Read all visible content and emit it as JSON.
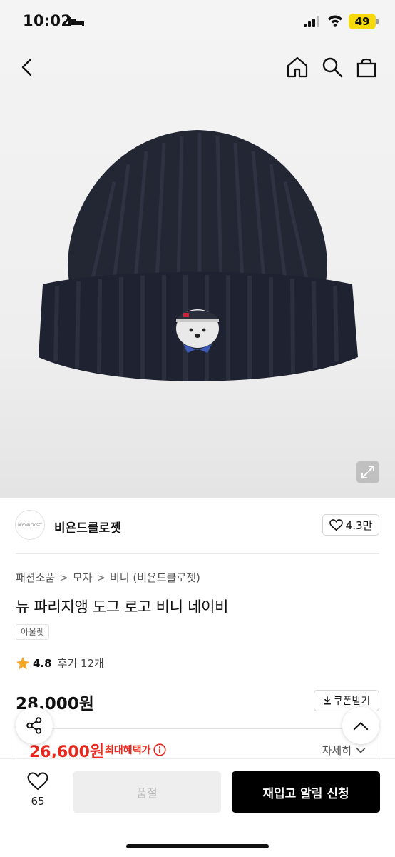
{
  "status_bar": {
    "time": "10:02",
    "battery": "49"
  },
  "brand": {
    "logo_text": "BEYOND CLOSET",
    "name": "비욘드클로젯",
    "likes": "4.3만"
  },
  "breadcrumb": [
    "패션소품",
    "모자",
    "비니 (비욘드클로젯)"
  ],
  "breadcrumb_separator": ">",
  "product": {
    "title": "뉴 파리지앵 도그 로고 비니 네이비",
    "tag": "아울렛",
    "rating": "4.8",
    "reviews": "후기 12개",
    "price": "28,000원",
    "coupon_label": "쿠폰받기",
    "sale_price": "26,600원",
    "max_benefit_label": "최대혜택가",
    "details_label": "자세히"
  },
  "bottom_bar": {
    "wish_count": "65",
    "soldout_label": "품절",
    "restock_label": "재입고 알림 신청"
  },
  "colors": {
    "accent_red": "#e8271d",
    "battery": "#f6d90a",
    "star": "#f5a623"
  },
  "icons": [
    "bed-icon",
    "signal-icon",
    "wifi-icon",
    "back-icon",
    "home-icon",
    "search-icon",
    "bag-icon",
    "expand-icon",
    "heart-icon",
    "star-icon",
    "download-icon",
    "info-icon",
    "chevron-down-icon",
    "share-icon",
    "chevron-up-icon"
  ]
}
